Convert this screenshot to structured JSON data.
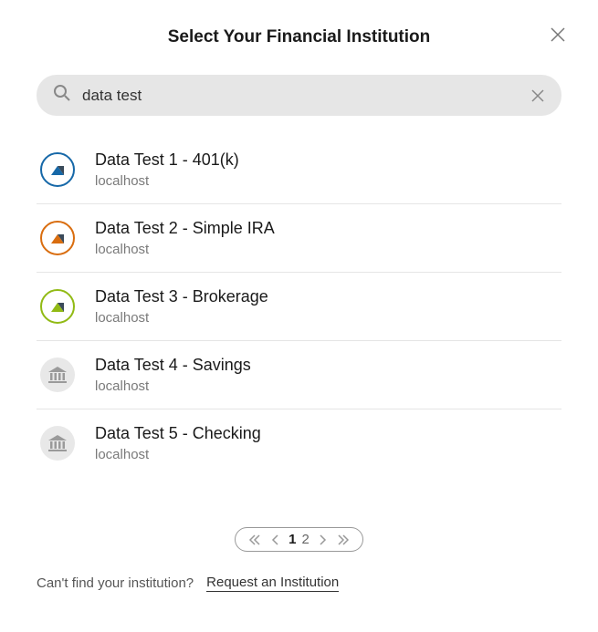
{
  "header": {
    "title": "Select Your Financial Institution"
  },
  "search": {
    "value": "data test"
  },
  "results": [
    {
      "name": "Data Test 1 - 401(k)",
      "domain": "localhost",
      "icon": "mountain",
      "color": "blue"
    },
    {
      "name": "Data Test 2 - Simple IRA",
      "domain": "localhost",
      "icon": "mountain",
      "color": "orange"
    },
    {
      "name": "Data Test 3 - Brokerage",
      "domain": "localhost",
      "icon": "mountain",
      "color": "green"
    },
    {
      "name": "Data Test 4 - Savings",
      "domain": "localhost",
      "icon": "bank",
      "color": "gray"
    },
    {
      "name": "Data Test 5 - Checking",
      "domain": "localhost",
      "icon": "bank",
      "color": "gray"
    }
  ],
  "pagination": {
    "pages": [
      "1",
      "2"
    ],
    "current": "1"
  },
  "footer": {
    "prompt": "Can't find your institution?",
    "link": "Request an Institution"
  }
}
